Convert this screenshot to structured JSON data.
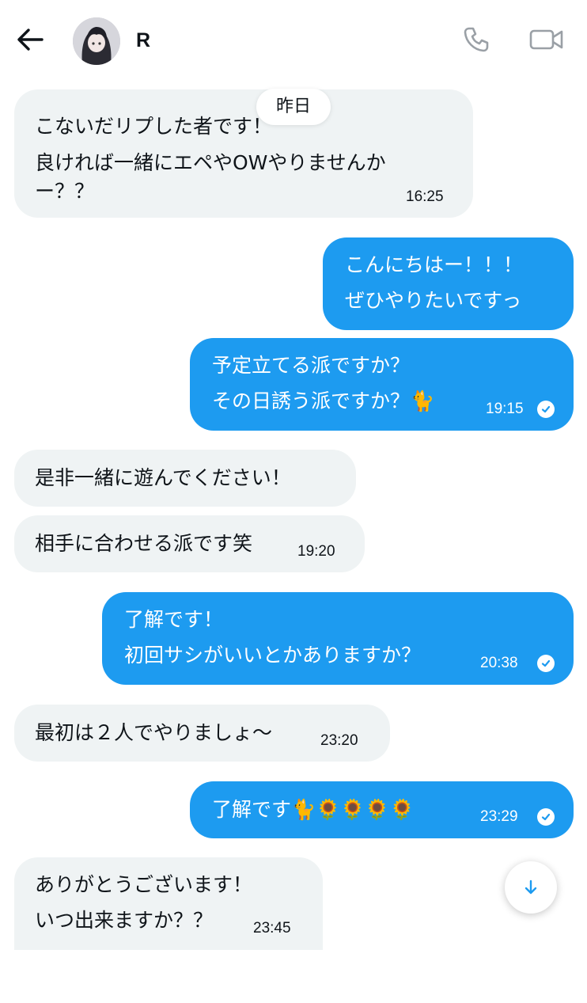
{
  "header": {
    "contact_name": "R",
    "back_icon": "arrow-left-icon",
    "call_icon": "phone-icon",
    "video_icon": "video-camera-icon"
  },
  "date_separator": "昨日",
  "messages": [
    {
      "direction": "received",
      "lines": [
        "こないだリプした者です！",
        "良ければ一緒にエペやOWやりませんか",
        "ー？？"
      ],
      "time": "16:25"
    },
    {
      "direction": "sent",
      "lines": [
        "こんにちはー！！！",
        "ぜひやりたいですっ"
      ],
      "time": ""
    },
    {
      "direction": "sent",
      "lines": [
        "予定立てる派ですか？",
        "その日誘う派ですか？🐈"
      ],
      "time": "19:15",
      "read": true
    },
    {
      "direction": "received",
      "lines": [
        "是非一緒に遊んでください！"
      ],
      "time": ""
    },
    {
      "direction": "received",
      "lines": [
        "相手に合わせる派です笑"
      ],
      "time": "19:20"
    },
    {
      "direction": "sent",
      "lines": [
        "了解です！",
        "初回サシがいいとかありますか？"
      ],
      "time": "20:38",
      "read": true
    },
    {
      "direction": "received",
      "lines": [
        "最初は２人でやりましょ〜"
      ],
      "time": "23:20"
    },
    {
      "direction": "sent",
      "lines": [
        "了解です🐈🌻🌻🌻🌻"
      ],
      "time": "23:29",
      "read": true
    },
    {
      "direction": "received",
      "lines": [
        "ありがとうございます！",
        "いつ出来ますか？？"
      ],
      "time": "23:45"
    }
  ],
  "scroll_down_icon": "arrow-down-icon",
  "colors": {
    "sent_bubble": "#1d9bf0",
    "received_bubble": "#eff3f4",
    "text": "#0f1419"
  }
}
